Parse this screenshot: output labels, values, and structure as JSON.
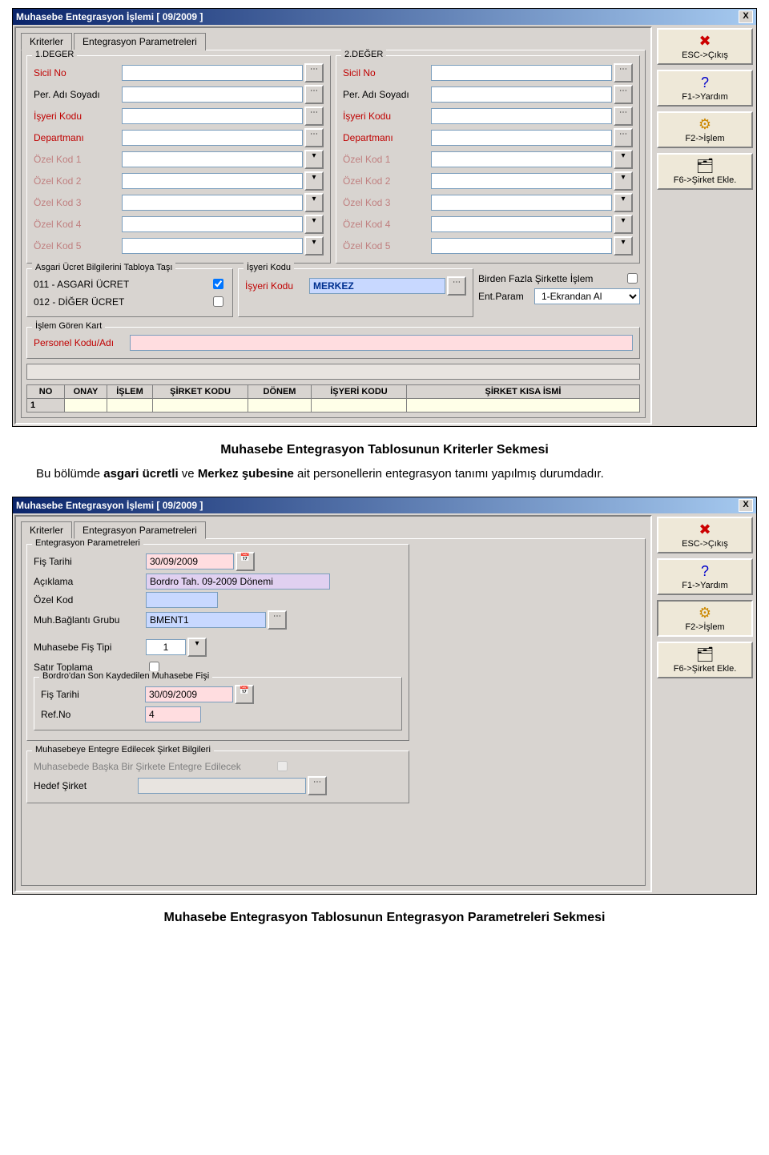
{
  "caption1": "Muhasebe Entegrasyon Tablosunun Kriterler Sekmesi",
  "para1_pre": "Bu bölümde ",
  "para1_b1": "asgari ücretli",
  "para1_mid": " ve ",
  "para1_b2": "Merkez şubesine",
  "para1_post": " ait personellerin entegrasyon tanımı yapılmış durumdadır.",
  "caption2": "Muhasebe Entegrasyon Tablosunun Entegrasyon Parametreleri Sekmesi",
  "shared": {
    "window_title": "Muhasebe Entegrasyon İşlemi [ 09/2009  ]",
    "tabs": {
      "kriterler": "Kriterler",
      "ent_param": "Entegrasyon Parametreleri"
    },
    "side": {
      "esc": "ESC->Çıkış",
      "f1": "F1->Yardım",
      "f2": "F2->İşlem",
      "f6": "F6->Şirket Ekle."
    }
  },
  "w1": {
    "grp1": "1.DEĞER",
    "grp2": "2.DEĞER",
    "lbl_sicil": "Sicil No",
    "lbl_per": "Per. Adı Soyadı",
    "lbl_isyeri": "İşyeri Kodu",
    "lbl_dept": "Departmanı",
    "lbl_ok1": "Özel Kod 1",
    "lbl_ok2": "Özel Kod 2",
    "lbl_ok3": "Özel Kod 3",
    "lbl_ok4": "Özel Kod 4",
    "lbl_ok5": "Özel Kod 5",
    "grp_asgari": "Asgari Ücret Bilgilerini Tabloya Taşı",
    "asgari_011": "011 - ASGARİ ÜCRET",
    "asgari_012": "012 - DİĞER ÜCRET",
    "grp_isyeri": "İşyeri Kodu",
    "isyeri_lbl": "İşyeri Kodu",
    "isyeri_val": "MERKEZ",
    "multi_lbl": "Birden Fazla Şirkette İşlem",
    "entparam_lbl": "Ent.Param",
    "entparam_val": "1-Ekrandan Al",
    "grp_islem": "İşlem Gören Kart",
    "islem_lbl": "Personel Kodu/Adı",
    "grid": {
      "h_no": "NO",
      "h_onay": "ONAY",
      "h_islem": "İŞLEM",
      "h_sk": "ŞİRKET KODU",
      "h_donem": "DÖNEM",
      "h_ik": "İŞYERİ KODU",
      "h_ski": "ŞİRKET KISA İSMİ",
      "c_no": "1"
    }
  },
  "w2": {
    "grp_ep": "Entegrasyon Parametreleri",
    "lbl_fist": "Fiş Tarihi",
    "val_fist": "30/09/2009",
    "lbl_acik": "Açıklama",
    "val_acik": "Bordro Tah. 09-2009 Dönemi",
    "lbl_ozel": "Özel Kod",
    "lbl_muhb": "Muh.Bağlantı Grubu",
    "val_muhb": "BMENT1",
    "lbl_mft": "Muhasebe Fiş Tipi",
    "val_mft": "1",
    "lbl_sat": "Satır Toplama",
    "grp_bordro": "Bordro'dan  Son Kaydedilen Muhasebe Fişi",
    "lbl_b_fist": "Fiş Tarihi",
    "val_b_fist": "30/09/2009",
    "lbl_refno": "Ref.No",
    "val_refno": "4",
    "grp_hedef": "Muhasebeye Entegre Edilecek Şirket Bilgileri",
    "lbl_mbse": "Muhasebede Başka Bir Şirkete Entegre Edilecek",
    "lbl_hedef": "Hedef Şirket"
  }
}
